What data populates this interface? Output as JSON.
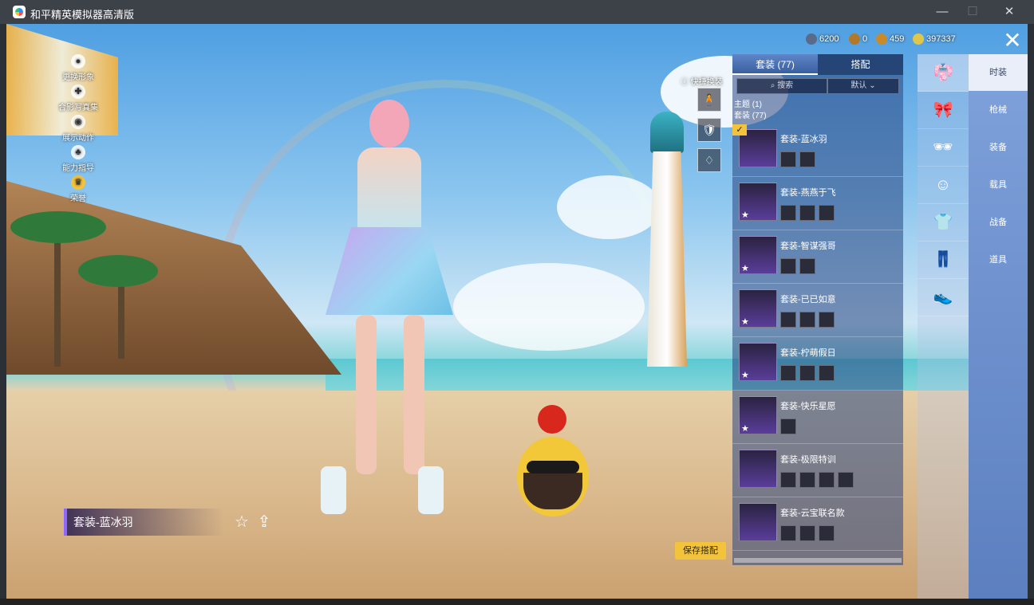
{
  "window": {
    "title": "和平精英模拟器高清版",
    "controls": {
      "minimize": "—",
      "maximize": "☐",
      "close": "✕"
    }
  },
  "left_menu": [
    {
      "label": "更换形象",
      "icon": "person-icon"
    },
    {
      "label": "合影写真集",
      "icon": "camera-icon"
    },
    {
      "label": "展示动作",
      "icon": "eye-icon"
    },
    {
      "label": "能力指导",
      "icon": "guide-icon"
    },
    {
      "label": "荣誉",
      "icon": "crown-icon"
    }
  ],
  "quick_swap": {
    "label": "快捷换装",
    "slots": [
      "🧍",
      "🛡",
      "♢"
    ]
  },
  "currency": [
    {
      "icon": "cash-icon",
      "value": "6200",
      "color": "#5a6a8a"
    },
    {
      "icon": "token-icon",
      "value": "0",
      "color": "#b07a2a"
    },
    {
      "icon": "coupon-icon",
      "value": "459",
      "color": "#c98a2a"
    },
    {
      "icon": "gold-icon",
      "value": "397337",
      "color": "#e0c64a"
    }
  ],
  "close_button": "✕",
  "current_outfit": {
    "name": "套装-蓝冰羽",
    "favorite_icon": "☆",
    "share_icon": "⇪"
  },
  "save_button": "保存搭配",
  "panel": {
    "tabs": [
      "套装 (77)",
      "搭配"
    ],
    "search_placeholder": "搜索",
    "sort_label": "默认",
    "section_theme": "主题 (1)",
    "section_suits": "套装 (77)",
    "items": [
      {
        "name": "套装-蓝冰羽",
        "selected": true,
        "starred": false,
        "pieces": 2
      },
      {
        "name": "套装-燕燕于飞",
        "selected": false,
        "starred": true,
        "pieces": 3
      },
      {
        "name": "套装-智谋强哥",
        "selected": false,
        "starred": true,
        "pieces": 2
      },
      {
        "name": "套装-已已如意",
        "selected": false,
        "starred": true,
        "pieces": 3
      },
      {
        "name": "套装-柠萌假日",
        "selected": false,
        "starred": true,
        "pieces": 3
      },
      {
        "name": "套装-快乐星愿",
        "selected": false,
        "starred": true,
        "pieces": 1
      },
      {
        "name": "套装-极限特训",
        "selected": false,
        "starred": false,
        "pieces": 4
      },
      {
        "name": "套装-云宝联名款",
        "selected": false,
        "starred": false,
        "pieces": 3
      }
    ]
  },
  "categories": [
    "suit-icon",
    "accessory-icon",
    "glasses-icon",
    "face-icon",
    "top-icon",
    "pants-icon",
    "shoes-icon"
  ],
  "category_glyphs": [
    "👘",
    "🎀",
    "🕶",
    "☺",
    "👕",
    "👖",
    "👟"
  ],
  "sub_tabs": [
    "时装",
    "枪械",
    "装备",
    "载具",
    "战备",
    "道具"
  ]
}
